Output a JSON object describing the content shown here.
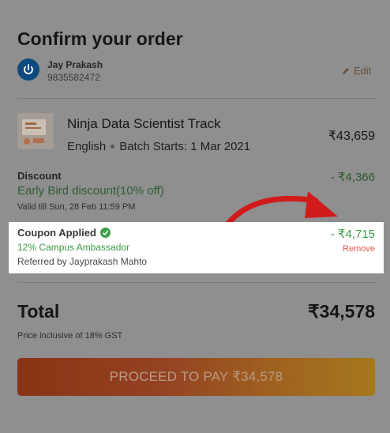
{
  "page": {
    "title": "Confirm your order"
  },
  "user": {
    "name": "Jay Prakash",
    "phone": "9835582472",
    "edit_label": "Edit"
  },
  "course": {
    "name": "Ninja Data Scientist Track",
    "language": "English",
    "batch": "Batch Starts: 1 Mar 2021",
    "price": "₹43,659"
  },
  "discount": {
    "label": "Discount",
    "name": "Early Bird discount(10% off)",
    "validity": "Valid till Sun, 28 Feb 11:59 PM",
    "amount": "- ₹4,366"
  },
  "coupon": {
    "label": "Coupon Applied",
    "code": "12% Campus Ambassador",
    "referral": "Referred by Jayprakash Mahto",
    "amount": "- ₹4,715",
    "remove_label": "Remove"
  },
  "total": {
    "label": "Total",
    "value": "₹34,578",
    "gst_note": "Price inclusive of 18% GST"
  },
  "pay_button": {
    "label": "PROCEED TO PAY ₹34,578"
  },
  "colors": {
    "accent_green": "#3d9a47",
    "remove_red": "#e0574f",
    "annotation_arrow": "#e01e1e"
  }
}
